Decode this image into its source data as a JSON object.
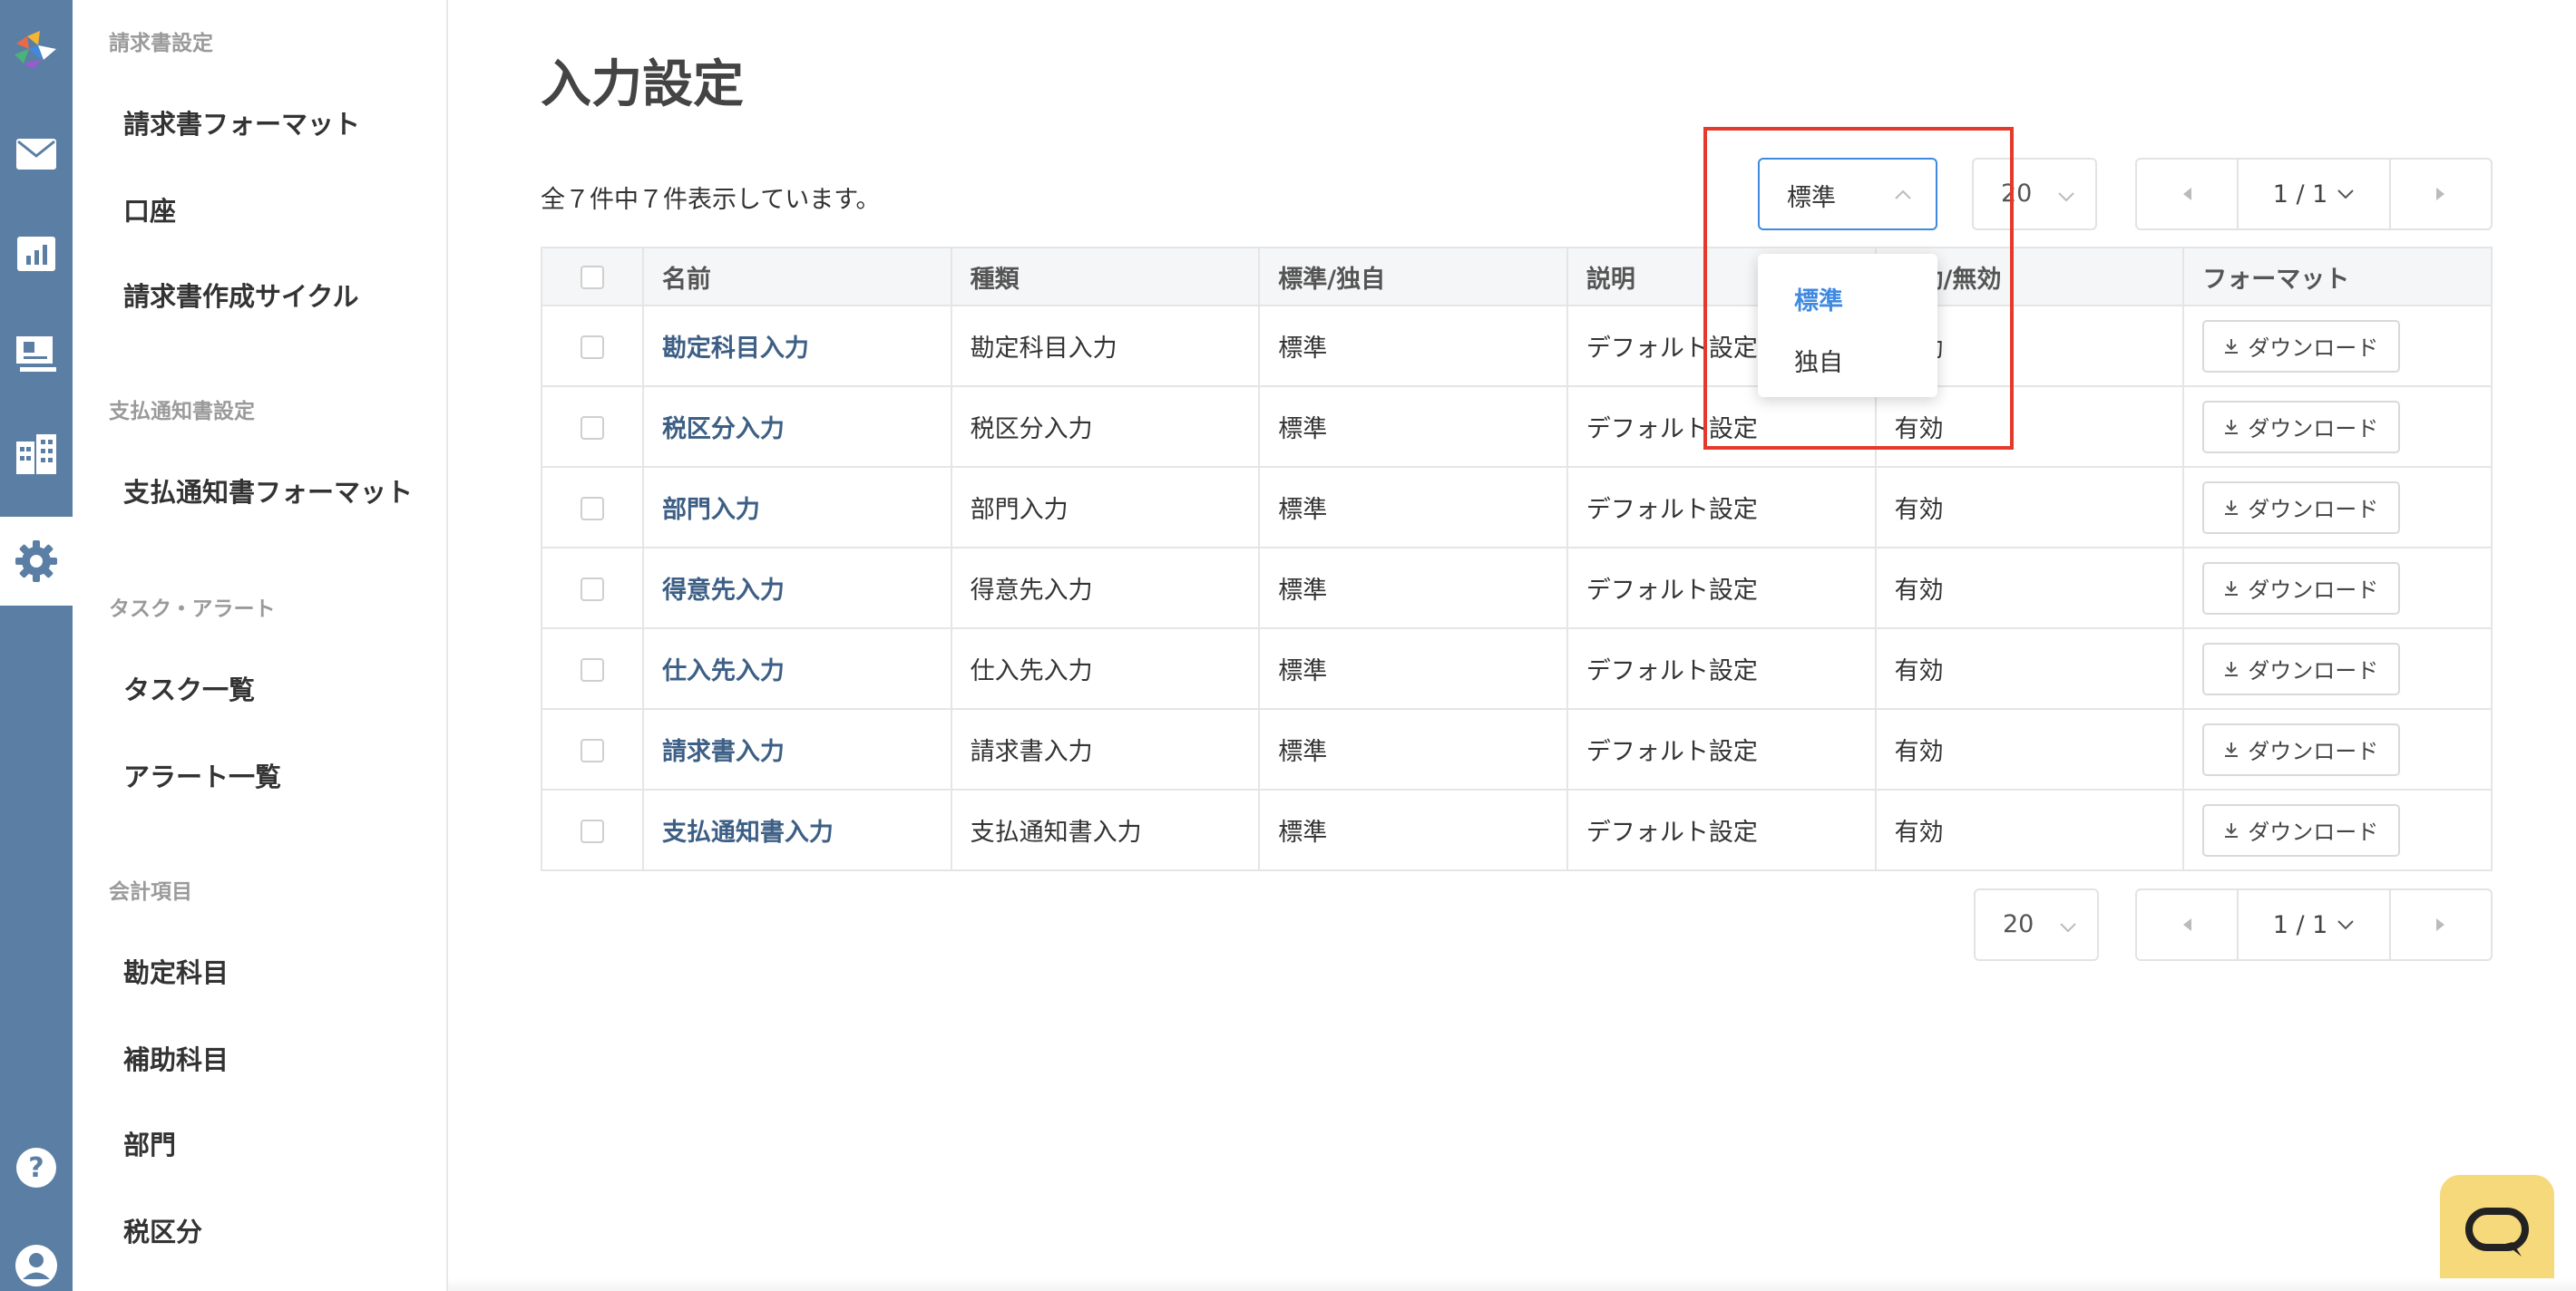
{
  "rail": {
    "icons": [
      "app-logo",
      "mail-icon",
      "chart-icon",
      "document-icon",
      "building-icon",
      "gear-icon",
      "help-icon",
      "user-icon"
    ]
  },
  "sidebar": {
    "sections": [
      {
        "title": "請求書設定",
        "items": [
          "請求書フォーマット",
          "口座",
          "請求書作成サイクル"
        ]
      },
      {
        "title": "支払通知書設定",
        "items": [
          "支払通知書フォーマット"
        ]
      },
      {
        "title": "タスク・アラート",
        "items": [
          "タスク一覧",
          "アラート一覧"
        ]
      },
      {
        "title": "会計項目",
        "items": [
          "勘定科目",
          "補助科目",
          "部門",
          "税区分"
        ]
      }
    ]
  },
  "main": {
    "title": "入力設定",
    "count_text": "全７件中７件表示しています。",
    "filter": {
      "value": "標準",
      "options": [
        "標準",
        "独自"
      ],
      "selected": "標準"
    },
    "page_size": "20",
    "pager": {
      "label": "1 / 1"
    }
  },
  "table": {
    "headers": [
      "名前",
      "種類",
      "標準/独自",
      "説明",
      "有効/無効",
      "フォーマット"
    ],
    "download_label": "ダウンロード",
    "rows": [
      {
        "name": "勘定科目入力",
        "type": "勘定科目入力",
        "std": "標準",
        "desc": "デフォルト設定",
        "status": "有効"
      },
      {
        "name": "税区分入力",
        "type": "税区分入力",
        "std": "標準",
        "desc": "デフォルト設定",
        "status": "有効"
      },
      {
        "name": "部門入力",
        "type": "部門入力",
        "std": "標準",
        "desc": "デフォルト設定",
        "status": "有効"
      },
      {
        "name": "得意先入力",
        "type": "得意先入力",
        "std": "標準",
        "desc": "デフォルト設定",
        "status": "有効"
      },
      {
        "name": "仕入先入力",
        "type": "仕入先入力",
        "std": "標準",
        "desc": "デフォルト設定",
        "status": "有効"
      },
      {
        "name": "請求書入力",
        "type": "請求書入力",
        "std": "標準",
        "desc": "デフォルト設定",
        "status": "有効"
      },
      {
        "name": "支払通知書入力",
        "type": "支払通知書入力",
        "std": "標準",
        "desc": "デフォルト設定",
        "status": "有効"
      }
    ]
  },
  "colors": {
    "rail": "#5b7ea4",
    "accent": "#3f8ae0",
    "link": "#3d5f85",
    "highlight": "#e53a2b",
    "chat": "#f6d97a"
  }
}
